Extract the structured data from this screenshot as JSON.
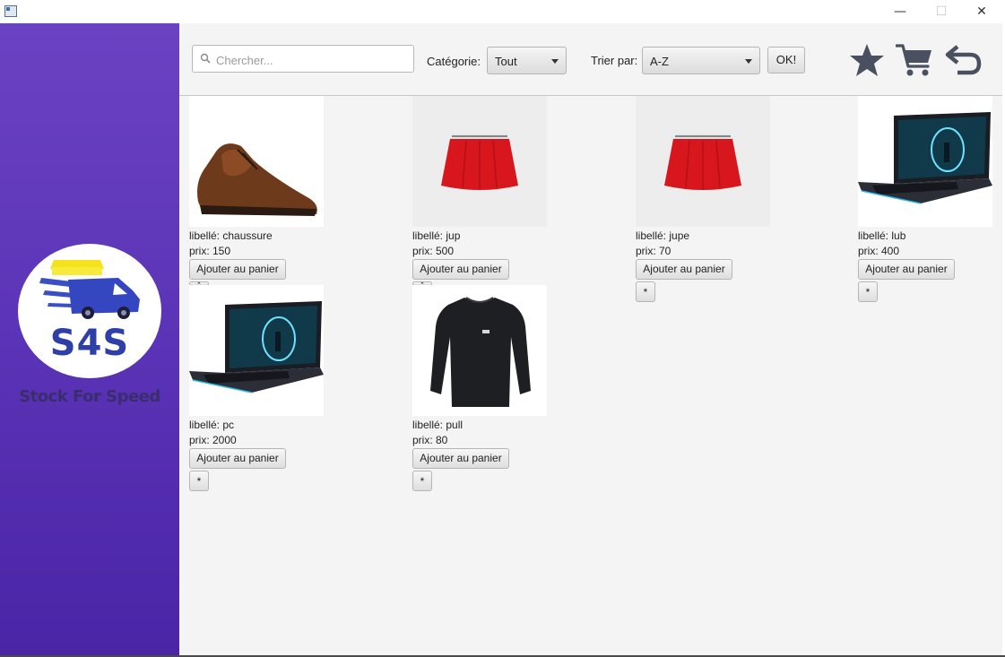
{
  "window": {
    "minimize_glyph": "—",
    "maximize_glyph": "☐",
    "close_glyph": "✕"
  },
  "sidebar": {
    "logo_text": "S4S",
    "tagline": "Stock For Speed"
  },
  "toolbar": {
    "search": {
      "placeholder": "Chercher...",
      "value": ""
    },
    "category_label": "Catégorie:",
    "category_value": "Tout",
    "sort_label": "Trier par:",
    "sort_value": "A-Z",
    "ok_label": "OK!",
    "icons": [
      "star-icon",
      "cart-icon",
      "back-arrow-icon"
    ]
  },
  "products": [
    {
      "label": "libellé: chaussure",
      "price": "prix: 150",
      "add_label": "Ajouter au panier",
      "fav_label": "*",
      "image": "brown leather boot"
    },
    {
      "label": "libellé: jup",
      "price": "prix: 500",
      "add_label": "Ajouter au panier",
      "fav_label": "*",
      "image": "red skirt"
    },
    {
      "label": "libellé: jupe",
      "price": "prix: 70",
      "add_label": "Ajouter au panier",
      "fav_label": "*",
      "image": "red skirt"
    },
    {
      "label": "libellé: lub",
      "price": "prix: 400",
      "add_label": "Ajouter au panier",
      "fav_label": "*",
      "image": "laptop"
    },
    {
      "label": "libellé: pc",
      "price": "prix: 2000",
      "add_label": "Ajouter au panier",
      "fav_label": "*",
      "image": "laptop"
    },
    {
      "label": "libellé: pull",
      "price": "prix: 80",
      "add_label": "Ajouter au panier",
      "fav_label": "*",
      "image": "black long-sleeve top"
    }
  ],
  "colors": {
    "sidebar_top": "#6a42c2",
    "sidebar_bottom": "#4a25a6",
    "icon_grey": "#4b5060",
    "logo_blue": "#2f3fa8"
  }
}
